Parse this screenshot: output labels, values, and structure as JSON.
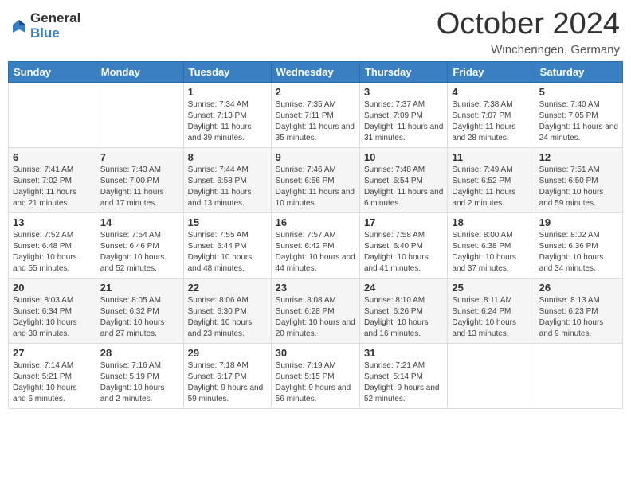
{
  "logo": {
    "general": "General",
    "blue": "Blue"
  },
  "title": {
    "month": "October 2024",
    "location": "Wincheringen, Germany"
  },
  "weekdays": [
    "Sunday",
    "Monday",
    "Tuesday",
    "Wednesday",
    "Thursday",
    "Friday",
    "Saturday"
  ],
  "weeks": [
    [
      {
        "day": "",
        "detail": ""
      },
      {
        "day": "",
        "detail": ""
      },
      {
        "day": "1",
        "detail": "Sunrise: 7:34 AM\nSunset: 7:13 PM\nDaylight: 11 hours and 39 minutes."
      },
      {
        "day": "2",
        "detail": "Sunrise: 7:35 AM\nSunset: 7:11 PM\nDaylight: 11 hours and 35 minutes."
      },
      {
        "day": "3",
        "detail": "Sunrise: 7:37 AM\nSunset: 7:09 PM\nDaylight: 11 hours and 31 minutes."
      },
      {
        "day": "4",
        "detail": "Sunrise: 7:38 AM\nSunset: 7:07 PM\nDaylight: 11 hours and 28 minutes."
      },
      {
        "day": "5",
        "detail": "Sunrise: 7:40 AM\nSunset: 7:05 PM\nDaylight: 11 hours and 24 minutes."
      }
    ],
    [
      {
        "day": "6",
        "detail": "Sunrise: 7:41 AM\nSunset: 7:02 PM\nDaylight: 11 hours and 21 minutes."
      },
      {
        "day": "7",
        "detail": "Sunrise: 7:43 AM\nSunset: 7:00 PM\nDaylight: 11 hours and 17 minutes."
      },
      {
        "day": "8",
        "detail": "Sunrise: 7:44 AM\nSunset: 6:58 PM\nDaylight: 11 hours and 13 minutes."
      },
      {
        "day": "9",
        "detail": "Sunrise: 7:46 AM\nSunset: 6:56 PM\nDaylight: 11 hours and 10 minutes."
      },
      {
        "day": "10",
        "detail": "Sunrise: 7:48 AM\nSunset: 6:54 PM\nDaylight: 11 hours and 6 minutes."
      },
      {
        "day": "11",
        "detail": "Sunrise: 7:49 AM\nSunset: 6:52 PM\nDaylight: 11 hours and 2 minutes."
      },
      {
        "day": "12",
        "detail": "Sunrise: 7:51 AM\nSunset: 6:50 PM\nDaylight: 10 hours and 59 minutes."
      }
    ],
    [
      {
        "day": "13",
        "detail": "Sunrise: 7:52 AM\nSunset: 6:48 PM\nDaylight: 10 hours and 55 minutes."
      },
      {
        "day": "14",
        "detail": "Sunrise: 7:54 AM\nSunset: 6:46 PM\nDaylight: 10 hours and 52 minutes."
      },
      {
        "day": "15",
        "detail": "Sunrise: 7:55 AM\nSunset: 6:44 PM\nDaylight: 10 hours and 48 minutes."
      },
      {
        "day": "16",
        "detail": "Sunrise: 7:57 AM\nSunset: 6:42 PM\nDaylight: 10 hours and 44 minutes."
      },
      {
        "day": "17",
        "detail": "Sunrise: 7:58 AM\nSunset: 6:40 PM\nDaylight: 10 hours and 41 minutes."
      },
      {
        "day": "18",
        "detail": "Sunrise: 8:00 AM\nSunset: 6:38 PM\nDaylight: 10 hours and 37 minutes."
      },
      {
        "day": "19",
        "detail": "Sunrise: 8:02 AM\nSunset: 6:36 PM\nDaylight: 10 hours and 34 minutes."
      }
    ],
    [
      {
        "day": "20",
        "detail": "Sunrise: 8:03 AM\nSunset: 6:34 PM\nDaylight: 10 hours and 30 minutes."
      },
      {
        "day": "21",
        "detail": "Sunrise: 8:05 AM\nSunset: 6:32 PM\nDaylight: 10 hours and 27 minutes."
      },
      {
        "day": "22",
        "detail": "Sunrise: 8:06 AM\nSunset: 6:30 PM\nDaylight: 10 hours and 23 minutes."
      },
      {
        "day": "23",
        "detail": "Sunrise: 8:08 AM\nSunset: 6:28 PM\nDaylight: 10 hours and 20 minutes."
      },
      {
        "day": "24",
        "detail": "Sunrise: 8:10 AM\nSunset: 6:26 PM\nDaylight: 10 hours and 16 minutes."
      },
      {
        "day": "25",
        "detail": "Sunrise: 8:11 AM\nSunset: 6:24 PM\nDaylight: 10 hours and 13 minutes."
      },
      {
        "day": "26",
        "detail": "Sunrise: 8:13 AM\nSunset: 6:23 PM\nDaylight: 10 hours and 9 minutes."
      }
    ],
    [
      {
        "day": "27",
        "detail": "Sunrise: 7:14 AM\nSunset: 5:21 PM\nDaylight: 10 hours and 6 minutes."
      },
      {
        "day": "28",
        "detail": "Sunrise: 7:16 AM\nSunset: 5:19 PM\nDaylight: 10 hours and 2 minutes."
      },
      {
        "day": "29",
        "detail": "Sunrise: 7:18 AM\nSunset: 5:17 PM\nDaylight: 9 hours and 59 minutes."
      },
      {
        "day": "30",
        "detail": "Sunrise: 7:19 AM\nSunset: 5:15 PM\nDaylight: 9 hours and 56 minutes."
      },
      {
        "day": "31",
        "detail": "Sunrise: 7:21 AM\nSunset: 5:14 PM\nDaylight: 9 hours and 52 minutes."
      },
      {
        "day": "",
        "detail": ""
      },
      {
        "day": "",
        "detail": ""
      }
    ]
  ]
}
